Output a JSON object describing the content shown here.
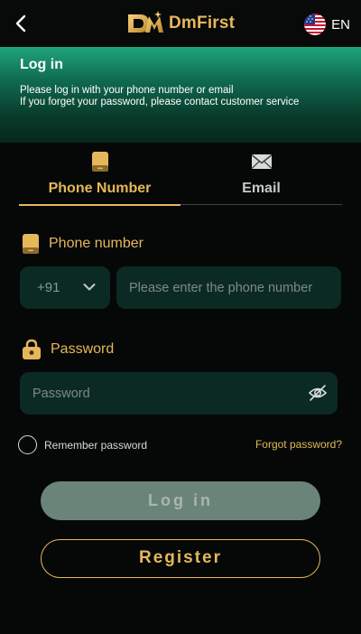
{
  "header": {
    "brand": "DmFirst",
    "language": "EN",
    "icons": {
      "back": "chevron-left-icon",
      "flag": "us-flag-icon"
    }
  },
  "hero": {
    "title": "Log in",
    "line1": "Please log in with your phone number or email",
    "line2": "If you forget your password, please contact customer service"
  },
  "tabs": [
    {
      "label": "Phone Number",
      "icon": "phone-icon",
      "active": true
    },
    {
      "label": "Email",
      "icon": "envelope-icon",
      "active": false
    }
  ],
  "phone": {
    "label": "Phone number",
    "country_code": "+91",
    "placeholder": "Please enter the phone number"
  },
  "password": {
    "label": "Password",
    "placeholder": "Password"
  },
  "remember": {
    "label": "Remember password",
    "checked": false
  },
  "forgot_label": "Forgot password?",
  "buttons": {
    "login": "Log in",
    "register": "Register"
  },
  "colors": {
    "accent": "#e6b75a",
    "background": "#050807",
    "field": "#0b2a23",
    "hero_top": "#1fa57a"
  }
}
